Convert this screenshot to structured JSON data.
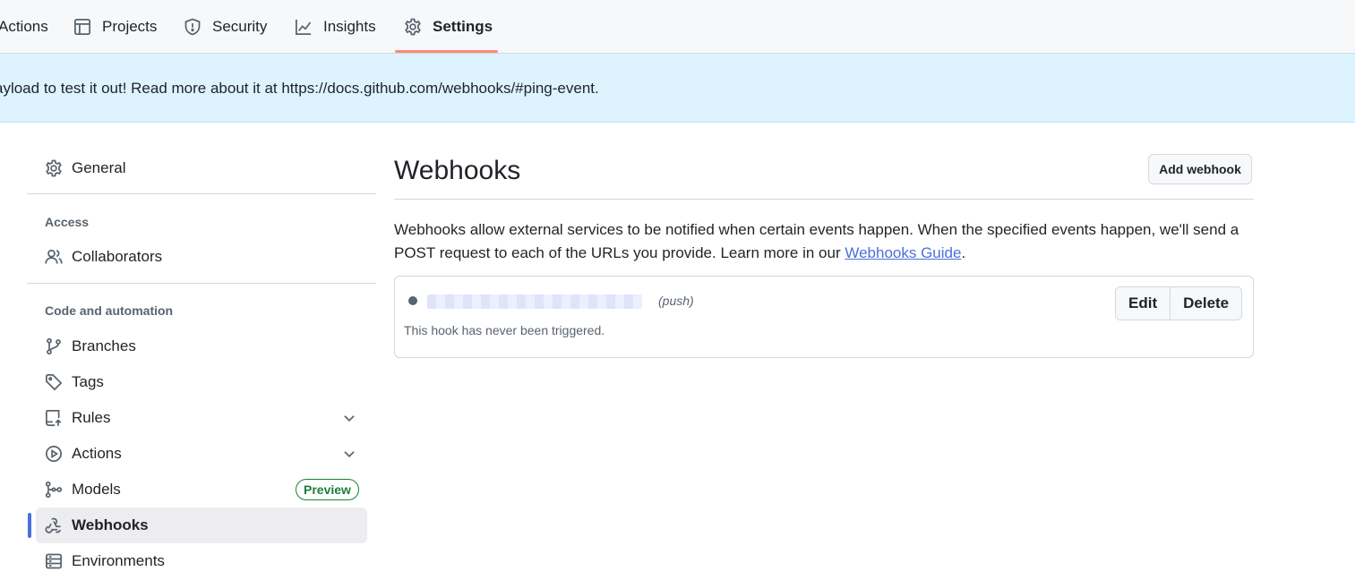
{
  "topnav": {
    "tabs": [
      {
        "label": "Actions",
        "icon": "play-icon"
      },
      {
        "label": "Projects",
        "icon": "table-icon"
      },
      {
        "label": "Security",
        "icon": "shield-icon"
      },
      {
        "label": "Insights",
        "icon": "graph-icon"
      },
      {
        "label": "Settings",
        "icon": "gear-icon",
        "selected": true
      }
    ],
    "selected_underline_color": "#fd8c73"
  },
  "flash": {
    "text": "ayload to test it out! Read more about it at https://docs.github.com/webhooks/#ping-event."
  },
  "sidebar": {
    "general": {
      "label": "General",
      "icon": "gear-icon"
    },
    "sections": {
      "access": "Access",
      "code_automation": "Code and automation"
    },
    "collaborators": {
      "label": "Collaborators",
      "icon": "people-icon"
    },
    "items": [
      {
        "label": "Branches",
        "icon": "git-branch-icon"
      },
      {
        "label": "Tags",
        "icon": "tag-icon"
      },
      {
        "label": "Rules",
        "icon": "repo-push-icon",
        "expandable": true
      },
      {
        "label": "Actions",
        "icon": "play-icon",
        "expandable": true
      },
      {
        "label": "Models",
        "icon": "ai-model-icon",
        "badge": "Preview"
      },
      {
        "label": "Webhooks",
        "icon": "webhook-icon",
        "active": true
      },
      {
        "label": "Environments",
        "icon": "server-icon"
      }
    ]
  },
  "main": {
    "title": "Webhooks",
    "add_button": "Add webhook",
    "description_before": "Webhooks allow external services to be notified when certain events happen. When the specified events happen, we'll send a POST request to each of the URLs you provide. Learn more in our ",
    "description_link": "Webhooks Guide",
    "description_after": ".",
    "hook": {
      "events": "(push)",
      "status": "This hook has never been triggered.",
      "edit_label": "Edit",
      "delete_label": "Delete"
    }
  },
  "colors": {
    "accent": "#4b70d8",
    "flash_bg": "#ddf4ff",
    "badge_green": "#1a7f37"
  }
}
